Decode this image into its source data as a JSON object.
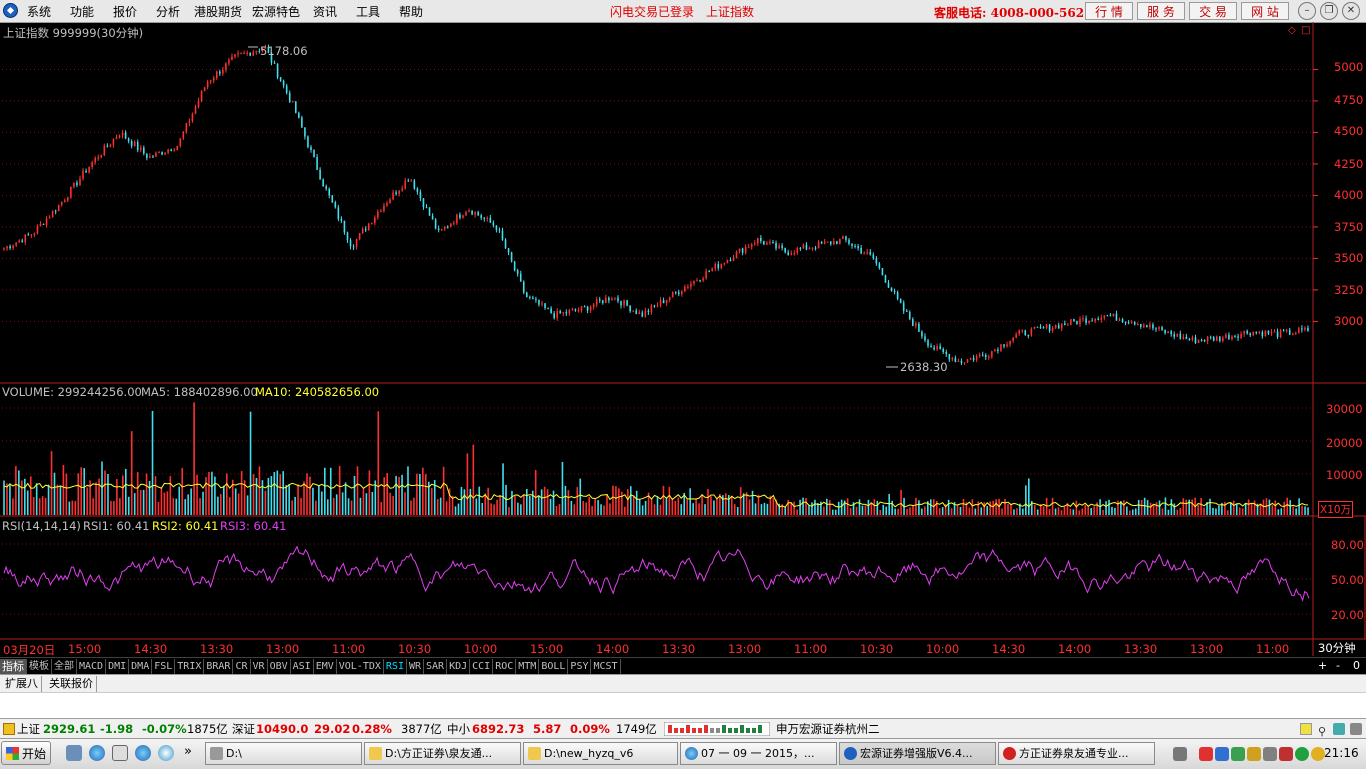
{
  "menu": {
    "items": [
      "系统",
      "功能",
      "报价",
      "分析",
      "港股期货",
      "宏源特色",
      "资讯",
      "工具",
      "帮助"
    ],
    "flash_status": "闪电交易已登录",
    "index_link": "上证指数",
    "hotline": "客服电话: 4008-000-562",
    "buttons": [
      "行 情",
      "服 务",
      "交 易",
      "网 站"
    ]
  },
  "chart": {
    "title": "上证指数 999999(30分钟)",
    "high_label": "5178.06",
    "low_label": "2638.30",
    "price_axis": [
      "5000",
      "4750",
      "4500",
      "4250",
      "4000",
      "3750",
      "3500",
      "3250",
      "3000"
    ],
    "volume_title": "VOLUME: 299244256.00",
    "ma5_title": "MA5: 188402896.00",
    "ma10_title": "MA10: 240582656.00",
    "volume_axis": [
      "30000",
      "20000",
      "10000"
    ],
    "volume_unit": "X10万",
    "rsi_title": "RSI(14,14,14)",
    "rsi1": "RSI1: 60.41",
    "rsi2": "RSI2: 60.41",
    "rsi3": "RSI3: 60.41",
    "rsi_axis": [
      "80.00",
      "50.00",
      "20.00"
    ],
    "time_axis": [
      "03月20日",
      "15:00",
      "14:30",
      "13:30",
      "13:00",
      "11:00",
      "10:30",
      "10:00",
      "15:00",
      "14:00",
      "13:30",
      "13:00",
      "11:00",
      "10:30",
      "10:00",
      "14:30",
      "14:00",
      "13:30",
      "13:00",
      "11:00"
    ],
    "period": "30分钟",
    "colors": {
      "up": "#ff3030",
      "down": "#40e0f0",
      "ma": "#ffff30",
      "rsi": "#e040f0"
    }
  },
  "chart_data": {
    "type": "line",
    "title": "上证指数 999999(30分钟)",
    "series": [
      {
        "name": "上证指数",
        "values": [
          3580,
          3700,
          3950,
          4250,
          4500,
          4300,
          4400,
          4900,
          5100,
          5178,
          4700,
          4100,
          3600,
          3900,
          4150,
          3700,
          3900,
          3750,
          3200,
          3050,
          3100,
          3200,
          3050,
          3200,
          3350,
          3500,
          3650,
          3550,
          3600,
          3650,
          3500,
          3100,
          2800,
          2680,
          2750,
          2900,
          2950,
          3000,
          3050,
          3000,
          2920,
          2850,
          2870,
          2920,
          2900,
          2930
        ]
      }
    ],
    "high": 5178.06,
    "low": 2638.3,
    "ylim": [
      2638.3,
      5178.06
    ],
    "indicators": {
      "volume": 299244256.0,
      "ma5": 188402896.0,
      "ma10": 240582656.0,
      "rsi1": 60.41,
      "rsi2": 60.41,
      "rsi3": 60.41
    }
  },
  "indicator_tabs": [
    "指标",
    "模板",
    "全部",
    "MACD",
    "DMI",
    "DMA",
    "FSL",
    "TRIX",
    "BRAR",
    "CR",
    "VR",
    "OBV",
    "ASI",
    "EMV",
    "VOL-TDX",
    "RSI",
    "WR",
    "SAR",
    "KDJ",
    "CCI",
    "ROC",
    "MTM",
    "BOLL",
    "PSY",
    "MCST"
  ],
  "active_indicator": "RSI",
  "zoom_controls": [
    "+",
    "-",
    "0"
  ],
  "ext_tabs": [
    "扩展八",
    "关联报价"
  ],
  "status": {
    "sh_label": "上证",
    "sh_value": "2929.61",
    "sh_change": "-1.98",
    "sh_pct": "-0.07%",
    "sh_amount": "1875亿",
    "sz_label": "深证",
    "sz_value": "10490.0",
    "sz_change": "29.02",
    "sz_pct": "0.28%",
    "sz_amount": "3877亿",
    "zx_label": "中小",
    "zx_value": "6892.73",
    "zx_change": "5.87",
    "zx_pct": "0.09%",
    "zx_amount": "1749亿",
    "broker": "申万宏源证券杭州二"
  },
  "taskbar": {
    "start": "开始",
    "tasks": [
      "D:\\",
      "D:\\方正证券\\泉友通...",
      "D:\\new_hyzq_v6",
      "07 一 09 一 2015，...",
      "宏源证券增强版V6.4...",
      "方正证券泉友通专业..."
    ],
    "clock": "21:16"
  }
}
